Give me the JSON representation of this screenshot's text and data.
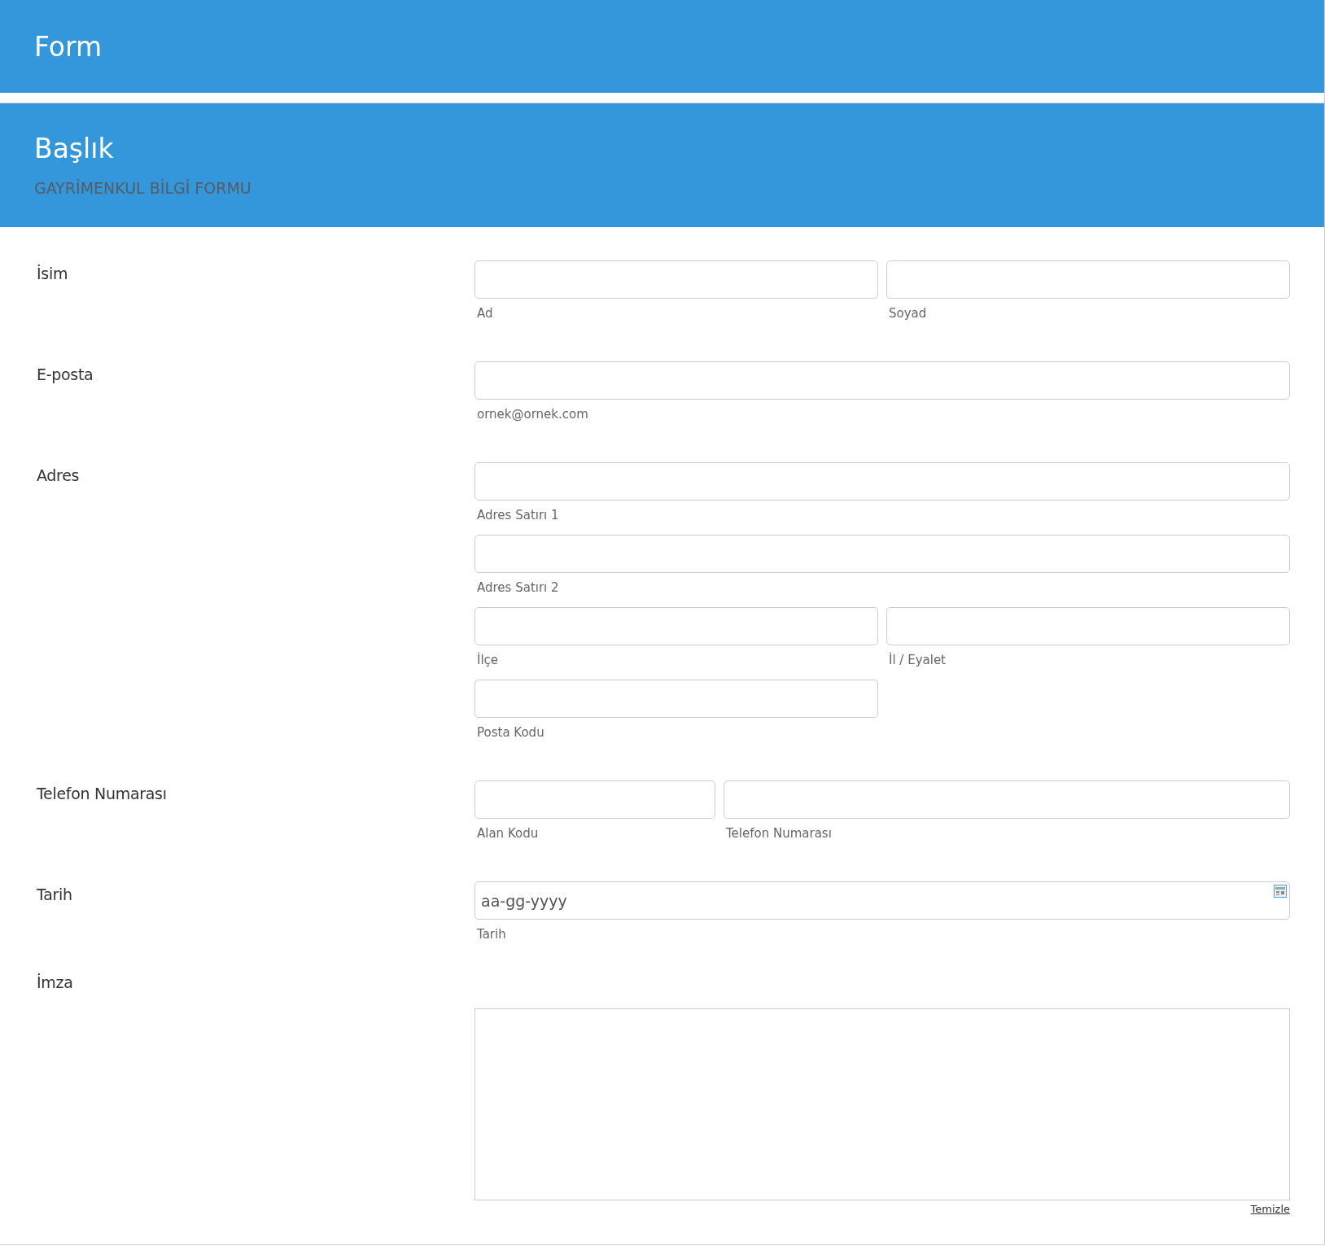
{
  "form_title": "Form",
  "section": {
    "title": "Başlık",
    "subtitle": "GAYRİMENKUL BİLGİ FORMU"
  },
  "fields": [
    {
      "label": "İsim",
      "kind": "inputs",
      "rows": [
        {
          "kind": "split",
          "inputs": [
            {
              "sublabel": "Ad"
            },
            {
              "sublabel": "Soyad"
            }
          ]
        }
      ]
    },
    {
      "label": "E-posta",
      "kind": "inputs",
      "rows": [
        {
          "kind": "full",
          "inputs": [
            {
              "sublabel": "ornek@ornek.com"
            }
          ]
        }
      ]
    },
    {
      "label": "Adres",
      "kind": "inputs",
      "rows": [
        {
          "kind": "full",
          "inputs": [
            {
              "sublabel": "Adres Satırı 1"
            }
          ]
        },
        {
          "kind": "full",
          "inputs": [
            {
              "sublabel": "Adres Satırı 2"
            }
          ]
        },
        {
          "kind": "split",
          "inputs": [
            {
              "sublabel": "İlçe"
            },
            {
              "sublabel": "İl / Eyalet"
            }
          ]
        },
        {
          "kind": "half",
          "inputs": [
            {
              "sublabel": "Posta Kodu"
            }
          ]
        }
      ]
    },
    {
      "label": "Telefon Numarası",
      "kind": "inputs",
      "rows": [
        {
          "kind": "phone",
          "inputs": [
            {
              "sublabel": "Alan Kodu"
            },
            {
              "sublabel": "Telefon Numarası"
            }
          ]
        }
      ]
    },
    {
      "label": "Tarih",
      "kind": "date",
      "placeholder": "aa-gg-yyyy",
      "sublabel": "Tarih"
    },
    {
      "label": "İmza",
      "kind": "signature",
      "clear_link": "Temizle"
    }
  ]
}
